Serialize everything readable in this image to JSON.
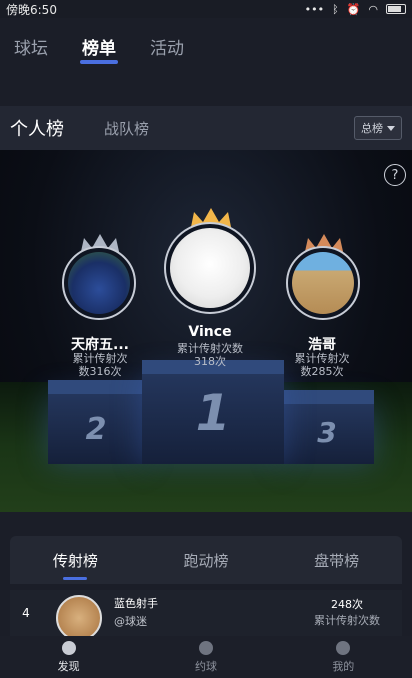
{
  "status_bar": {
    "time": "傍晚6:50",
    "icons": [
      "dots-icon",
      "bluetooth-icon",
      "alarm-icon",
      "wifi-icon",
      "battery-icon"
    ]
  },
  "top_tabs": [
    {
      "label": "球坛",
      "active": false
    },
    {
      "label": "榜单",
      "active": true
    },
    {
      "label": "活动",
      "active": false
    }
  ],
  "sub_tabs": {
    "personal": "个人榜",
    "team": "战队榜",
    "filter": "总榜"
  },
  "podium": {
    "first": {
      "name": "Vince",
      "count": "累计传射次数",
      "count2": "318次",
      "rank": "1"
    },
    "second": {
      "name": "天府五...",
      "count": "累计传射次",
      "count2": "数316次",
      "rank": "2"
    },
    "third": {
      "name": "浩哥",
      "count": "累计传射次",
      "count2": "数285次",
      "rank": "3"
    }
  },
  "board_tabs": [
    {
      "label": "传射榜",
      "active": true
    },
    {
      "label": "跑动榜",
      "active": false
    },
    {
      "label": "盘带榜",
      "active": false
    }
  ],
  "list": [
    {
      "rank": "4",
      "name": "蓝色射手",
      "tag": "@球迷",
      "value": "248次",
      "value_label": "累计传射次数"
    }
  ],
  "bottom_nav": [
    {
      "label": "发现",
      "active": true
    },
    {
      "label": "约球",
      "active": false
    },
    {
      "label": "我的",
      "active": false
    }
  ],
  "colors": {
    "accent": "#4a6fe0",
    "gold": "#f2b64a",
    "silver": "#aeb6c4",
    "bronze": "#d48a5a"
  }
}
